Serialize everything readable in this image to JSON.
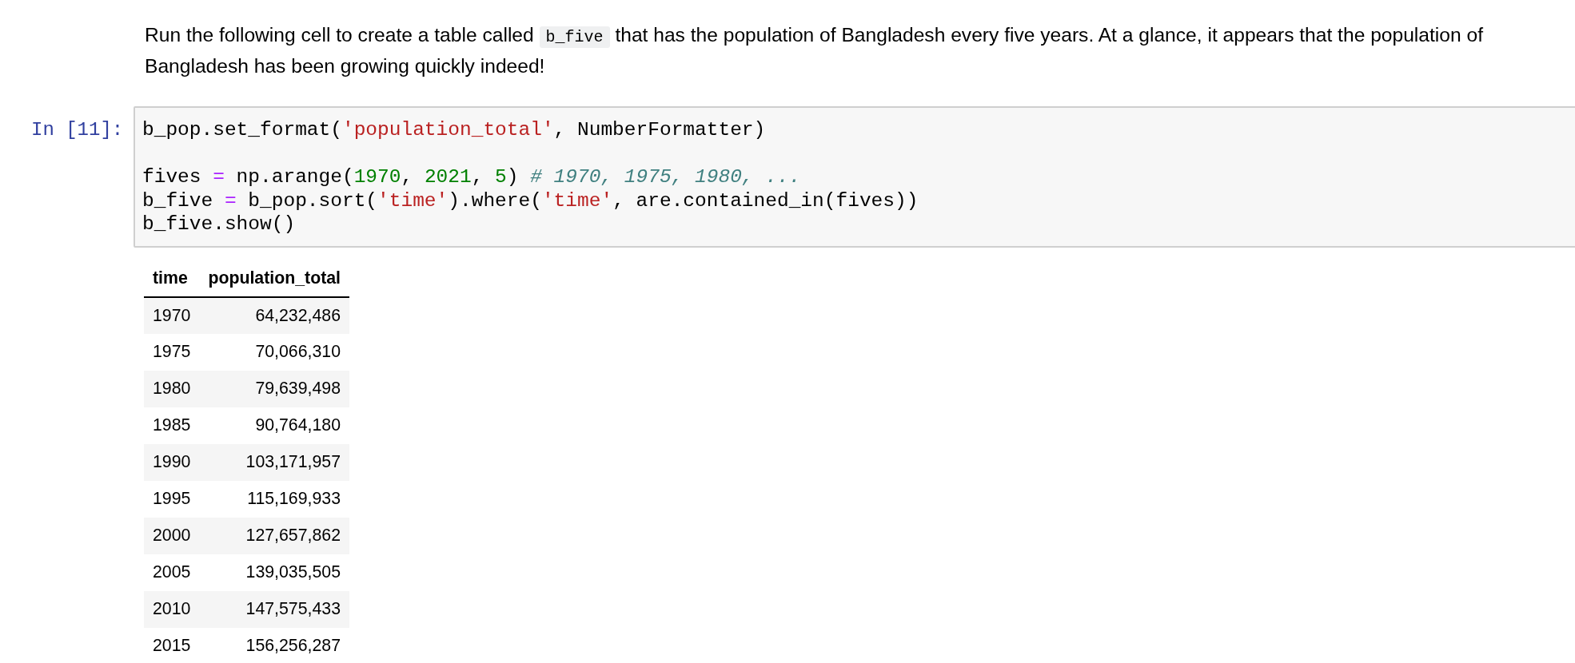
{
  "markdown_cell": {
    "segments": [
      {
        "kind": "text",
        "text": "Run the following cell to create a table called "
      },
      {
        "kind": "code",
        "text": "b_five"
      },
      {
        "kind": "text",
        "text": " that has the population of Bangladesh every five years. At a glance, it appears that the population of Bangladesh has been growing quickly indeed!"
      }
    ]
  },
  "code_cell": {
    "prompt": "In [11]:",
    "lines": [
      {
        "kind": "code",
        "tokens": [
          {
            "kind": "plain",
            "text": "b_pop.set_format("
          },
          {
            "kind": "string",
            "text": "'population_total'"
          },
          {
            "kind": "plain",
            "text": ", NumberFormatter)"
          }
        ]
      },
      {
        "kind": "blank"
      },
      {
        "kind": "code",
        "tokens": [
          {
            "kind": "plain",
            "text": "fives "
          },
          {
            "kind": "operator",
            "text": "="
          },
          {
            "kind": "plain",
            "text": " np.arange("
          },
          {
            "kind": "number",
            "text": "1970"
          },
          {
            "kind": "plain",
            "text": ", "
          },
          {
            "kind": "number",
            "text": "2021"
          },
          {
            "kind": "plain",
            "text": ", "
          },
          {
            "kind": "number",
            "text": "5"
          },
          {
            "kind": "plain",
            "text": ") "
          },
          {
            "kind": "comment",
            "text": "# 1970, 1975, 1980, ..."
          }
        ]
      },
      {
        "kind": "code",
        "tokens": [
          {
            "kind": "plain",
            "text": "b_five "
          },
          {
            "kind": "operator",
            "text": "="
          },
          {
            "kind": "plain",
            "text": " b_pop.sort("
          },
          {
            "kind": "string",
            "text": "'time'"
          },
          {
            "kind": "plain",
            "text": ").where("
          },
          {
            "kind": "string",
            "text": "'time'"
          },
          {
            "kind": "plain",
            "text": ", are.contained_in(fives))"
          }
        ]
      },
      {
        "kind": "code",
        "tokens": [
          {
            "kind": "plain",
            "text": "b_five.show()"
          }
        ]
      }
    ]
  },
  "output_table": {
    "columns": [
      "time",
      "population_total"
    ],
    "rows": [
      [
        "1970",
        "64,232,486"
      ],
      [
        "1975",
        "70,066,310"
      ],
      [
        "1980",
        "79,639,498"
      ],
      [
        "1985",
        "90,764,180"
      ],
      [
        "1990",
        "103,171,957"
      ],
      [
        "1995",
        "115,169,933"
      ],
      [
        "2000",
        "127,657,862"
      ],
      [
        "2005",
        "139,035,505"
      ],
      [
        "2010",
        "147,575,433"
      ],
      [
        "2015",
        "156,256,287"
      ]
    ]
  }
}
